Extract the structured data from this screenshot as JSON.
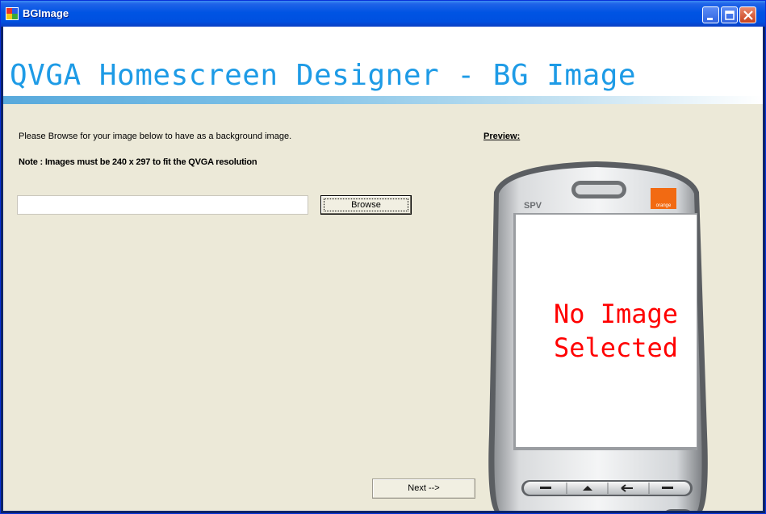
{
  "window": {
    "title": "BGImage"
  },
  "header": {
    "title": "QVGA Homescreen Designer - BG Image"
  },
  "instructions": {
    "browse_prompt": "Please Browse for your image below to have as a background image.",
    "note": "Note : Images must be 240 x 297 to fit the QVGA resolution"
  },
  "file_path": {
    "value": "",
    "placeholder": ""
  },
  "buttons": {
    "browse": "Browse",
    "next": "Next -->"
  },
  "preview": {
    "label": "Preview:",
    "placeholder_text": "No Image\nSelected",
    "phone_brand": "SPV",
    "phone_logo": "orange"
  },
  "colors": {
    "header_title": "#1e9be6",
    "no_image_text": "#ff0000",
    "titlebar": "#0054e3"
  }
}
